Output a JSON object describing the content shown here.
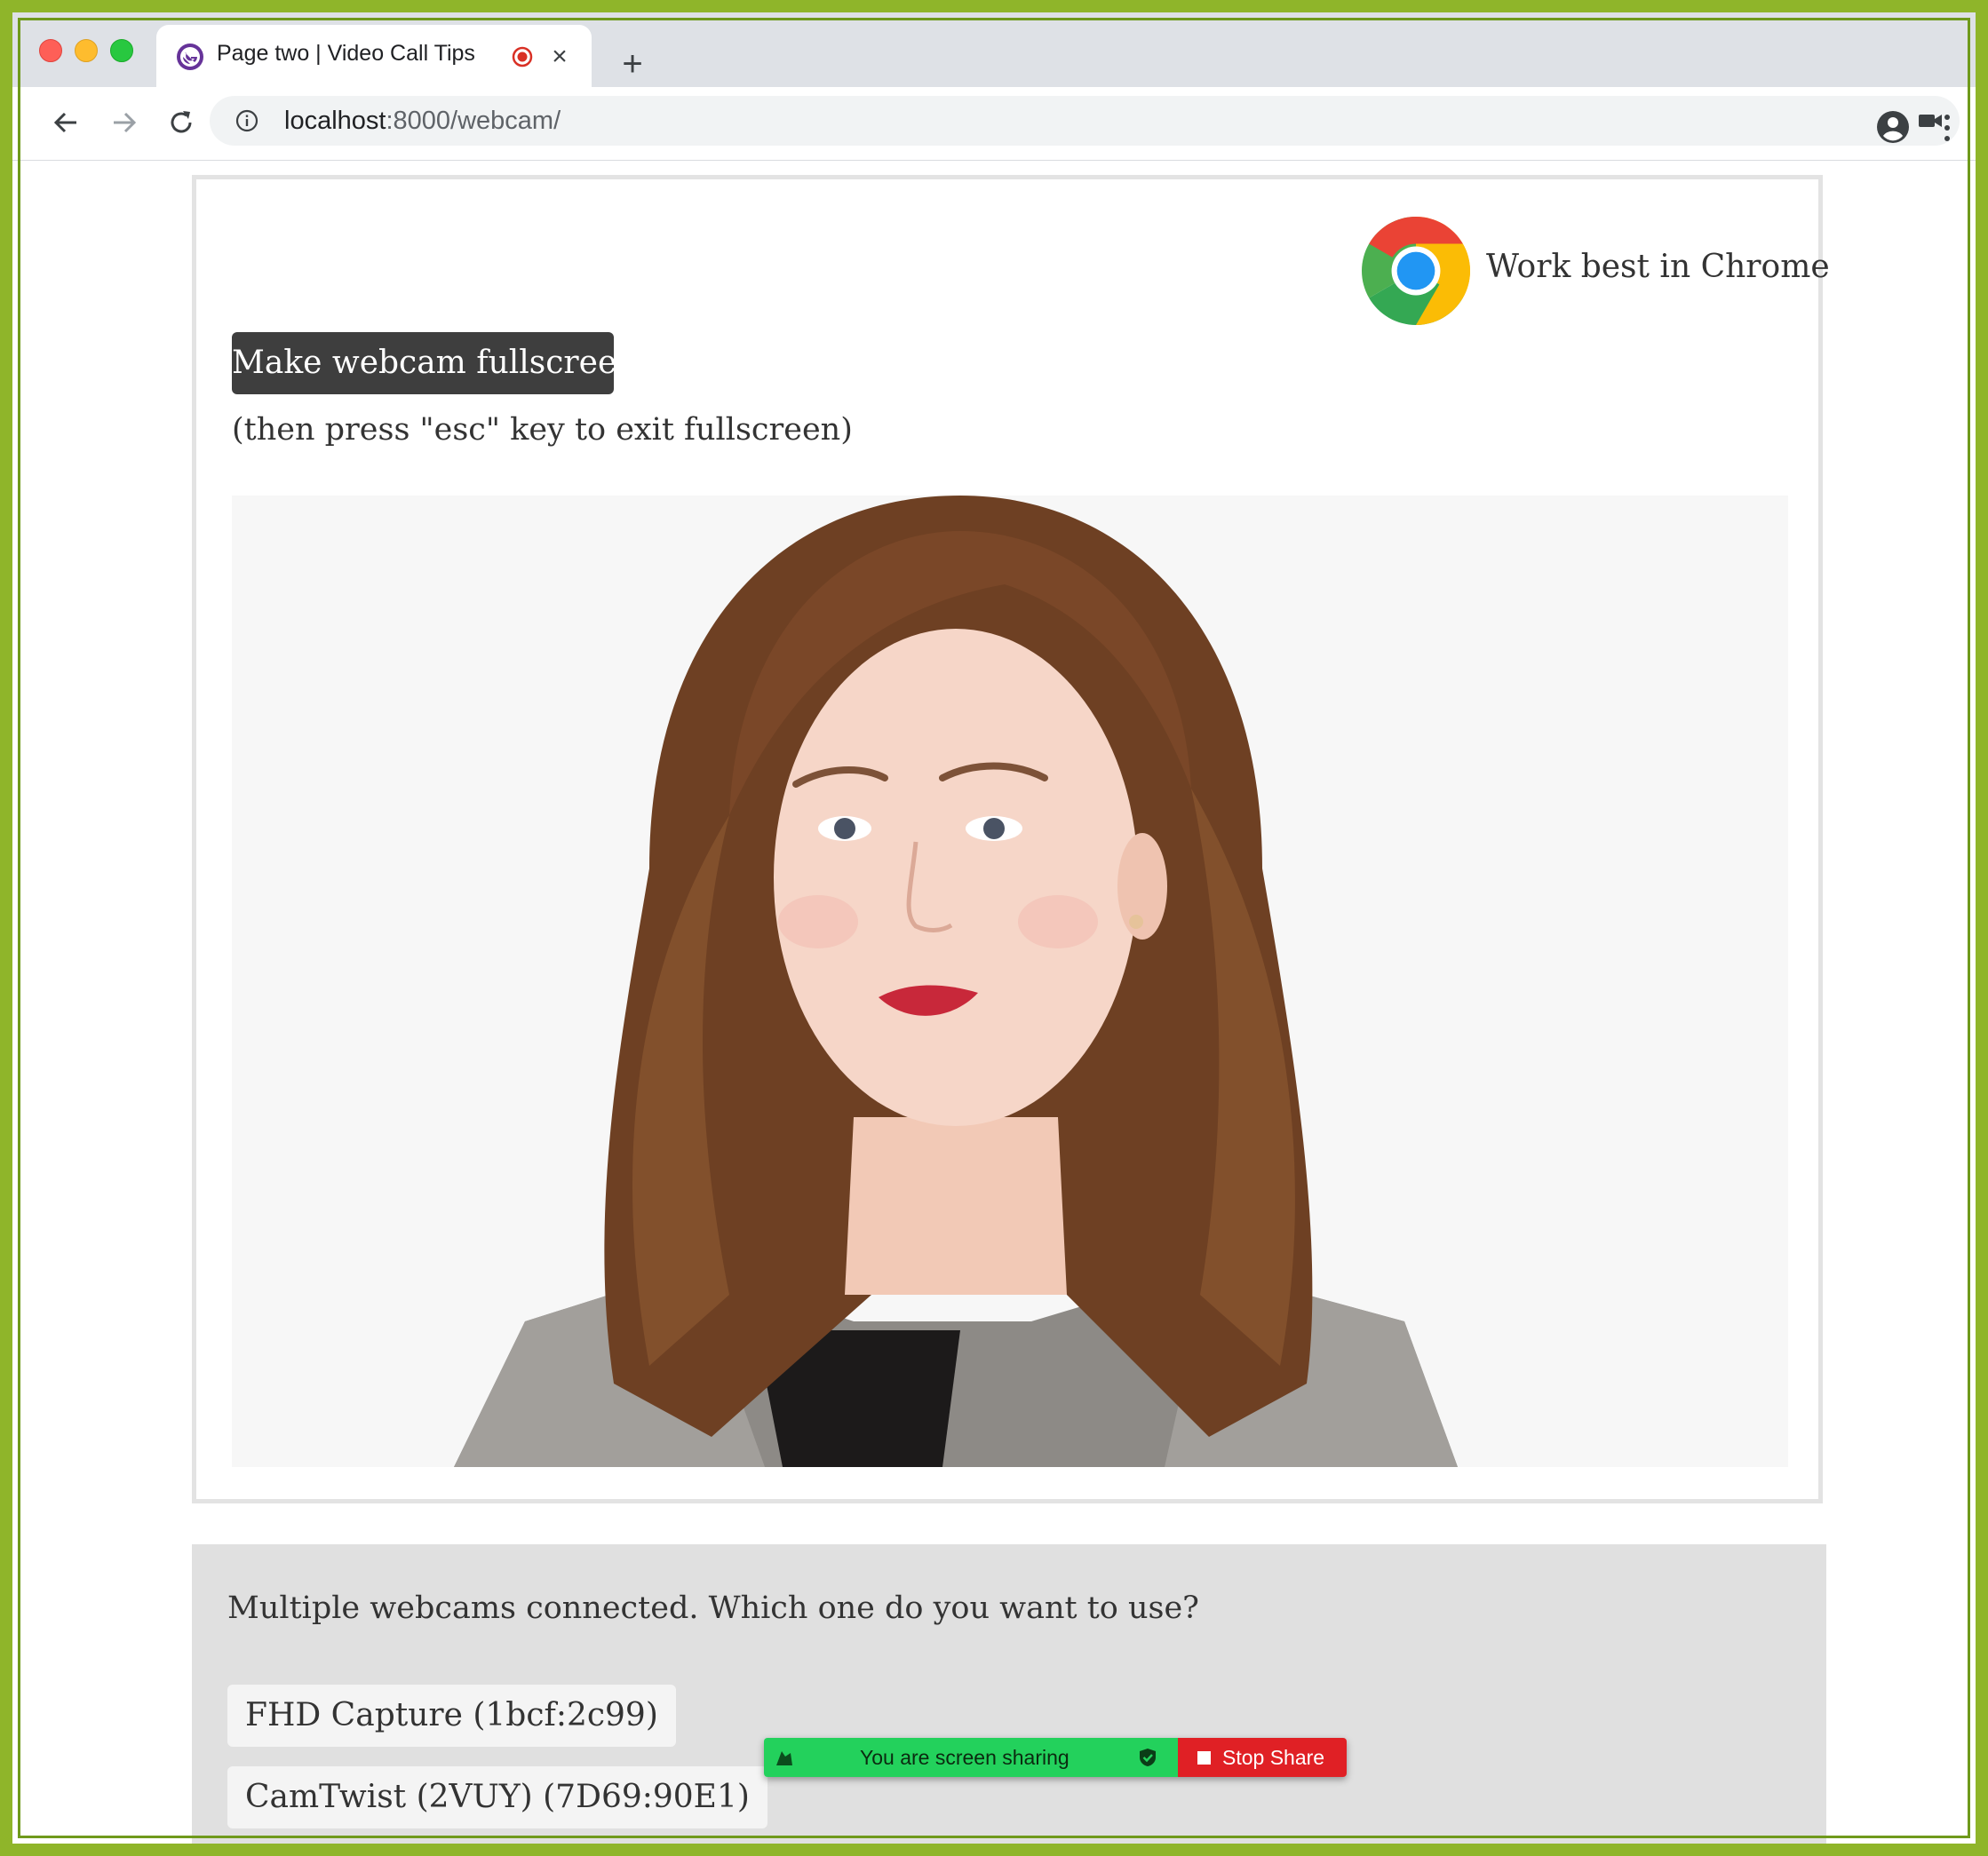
{
  "browser": {
    "tab": {
      "title": "Page two | Video Call Tips",
      "recording_indicator": "recording-icon",
      "close_icon": "close-icon"
    },
    "new_tab_icon": "plus-icon",
    "nav": {
      "back_icon": "back-arrow-icon",
      "forward_icon": "forward-arrow-icon",
      "reload_icon": "reload-icon"
    },
    "address_bar": {
      "host": "localhost",
      "path": ":8000/webcam/",
      "info_icon": "info-icon",
      "camera_icon": "camera-icon",
      "bookmark_icon": "star-icon"
    },
    "profile_icon": "profile-icon",
    "menu_icon": "kebab-menu-icon",
    "colors": {
      "tabstrip": "#dee1e6",
      "frame_border": "#8fb52a"
    }
  },
  "page": {
    "chrome_note": "Work best in Chrome",
    "fullscreen_button": "Make webcam fullscreen",
    "fullscreen_hint": "(then press \"esc\" key to exit fullscreen)",
    "webcam_feed": "webcam-video",
    "camera_question": "Multiple webcams connected. Which one do you want to use?",
    "camera_options": [
      "FHD Capture (1bcf:2c99)",
      "CamTwist (2VUY) (7D69:90E1)"
    ]
  },
  "screen_share": {
    "status": "You are screen sharing",
    "stop_label": "Stop Share",
    "colors": {
      "status_bg": "#23d15c",
      "stop_bg": "#e02025"
    }
  }
}
